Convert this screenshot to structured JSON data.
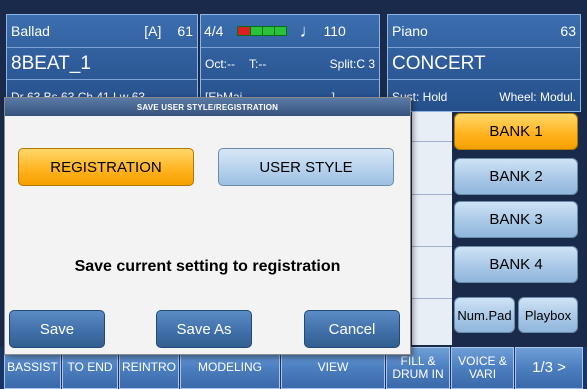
{
  "header": {
    "left": {
      "style_category": "Ballad",
      "variation": "[A]",
      "style_number": "61",
      "style_name": "8BEAT_1",
      "info": "Dr 63  Bs 63  Ch 41  Lw 63"
    },
    "mid": {
      "time_signature": "4/4",
      "tempo_icon": "quarter-note-icon",
      "tempo_glyph": "♩",
      "tempo": "110",
      "octave": "Oct:--",
      "transpose": "T:--",
      "split": "Split:C 3",
      "chord": "[EbMaj",
      "chord_end": "]"
    },
    "right": {
      "category": "Piano",
      "number": "63",
      "voice_name": "CONCERT",
      "sustain": "Sust: Hold",
      "wheel": "Wheel: Modul."
    }
  },
  "banks": [
    "BANK 1",
    "BANK 2",
    "BANK 3",
    "BANK 4"
  ],
  "active_bank": 0,
  "side_buttons": {
    "numpad": "Num.Pad",
    "playbox": "Playbox"
  },
  "dialog": {
    "title": "SAVE USER STYLE/REGISTRATION",
    "options": {
      "registration": "REGISTRATION",
      "user_style": "USER STYLE"
    },
    "message": "Save current setting to registration",
    "buttons": {
      "save": "Save",
      "save_as": "Save As",
      "cancel": "Cancel"
    }
  },
  "bottom": {
    "bassist": "BASSIST",
    "to_end": "TO END",
    "reintro": "REINTRO",
    "modeling": "MODELING",
    "view": "VIEW",
    "fill_line1": "FILL &",
    "fill_line2": "DRUM IN",
    "voice_line1": "VOICE &",
    "voice_line2": "VARI",
    "page": "1/3 >"
  },
  "colors": {
    "accent_active": "#ffb21c",
    "header_blue": "#2f5c9a",
    "button_blue": "#4c7fc0"
  }
}
